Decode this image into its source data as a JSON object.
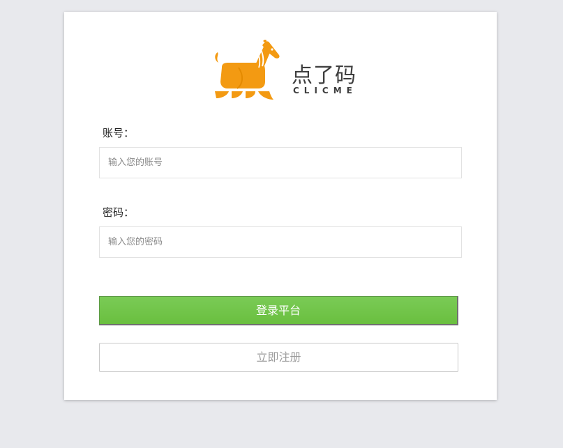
{
  "brand": {
    "name": "点了码",
    "subtitle": "CLICME",
    "accent_color": "#f39a12",
    "logo_icon": "horse-logo-icon"
  },
  "form": {
    "account_label": "账号：",
    "account_placeholder": "输入您的账号",
    "account_value": "",
    "password_label": "密码：",
    "password_placeholder": "输入您的密码",
    "password_value": ""
  },
  "actions": {
    "login_label": "登录平台",
    "login_color": "#6ebf45",
    "register_label": "立即注册"
  }
}
